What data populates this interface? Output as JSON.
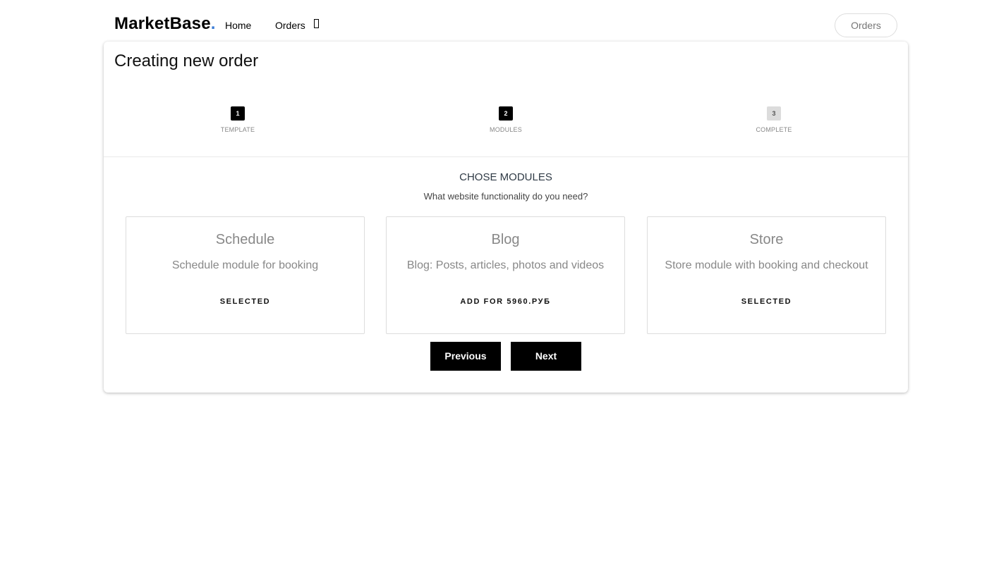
{
  "nav": {
    "brand": "MarketBase",
    "brand_dot": ".",
    "home": "Home",
    "orders": "Orders",
    "orders_button": "Orders"
  },
  "page": {
    "title": "Creating new order"
  },
  "steps": [
    {
      "number": "1",
      "label": "TEMPLATE",
      "state": "done"
    },
    {
      "number": "2",
      "label": "MODULES",
      "state": "active"
    },
    {
      "number": "3",
      "label": "COMPLETE",
      "state": "inactive"
    }
  ],
  "section": {
    "title": "CHOSE MODULES",
    "subtitle": "What website functionality do you need?"
  },
  "modules": [
    {
      "name": "Schedule",
      "description": "Schedule module for booking",
      "action": "SELECTED"
    },
    {
      "name": "Blog",
      "description": "Blog: Posts, articles, photos and videos",
      "action": "ADD FOR 5960.РУБ"
    },
    {
      "name": "Store",
      "description": "Store module with booking and checkout",
      "action": "SELECTED"
    }
  ],
  "buttons": {
    "previous": "Previous",
    "next": "Next"
  },
  "colors": {
    "brand_dot": "#3a7bd5",
    "primary_button": "#000000",
    "step_active": "#000000",
    "step_inactive": "#dcdcdc"
  }
}
